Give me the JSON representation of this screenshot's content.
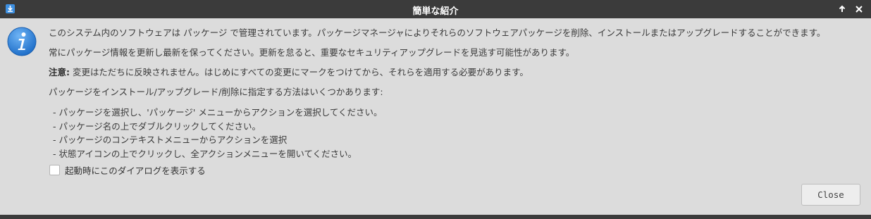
{
  "window": {
    "title": "簡単な紹介",
    "app_icon": "download-arrow-icon",
    "maximize_icon": "arrow-up-icon",
    "close_icon": "close-x-icon"
  },
  "info_icon": "info-icon",
  "paragraphs": {
    "p1": "このシステム内のソフトウェアは パッケージ で管理されています。パッケージマネージャによりそれらのソフトウェアパッケージを削除、インストールまたはアップグレードすることができます。",
    "p2": "常にパッケージ情報を更新し最新を保ってください。更新を怠ると、重要なセキュリティアップグレードを見逃す可能性があります。",
    "p3_label": "注意:",
    "p3_text": " 変更はただちに反映されません。はじめにすべての変更にマークをつけてから、それらを適用する必要があります。",
    "p4": "パッケージをインストール/アップグレード/削除に指定する方法はいくつかあります:"
  },
  "list_items": [
    "-  パッケージを選択し、'パッケージ' メニューからアクションを選択してください。",
    "-  パッケージ名の上でダブルクリックしてください。",
    "-  パッケージのコンテキストメニューからアクションを選択",
    "-  状態アイコンの上でクリックし、全アクションメニューを開いてください。"
  ],
  "checkbox": {
    "label": "起動時にこのダイアログを表示する",
    "checked": false
  },
  "buttons": {
    "close_label": "Close"
  },
  "colors": {
    "titlebar": "#3b3b3b",
    "background": "#dcdcdc",
    "info_blue": "#2b7fd6"
  }
}
